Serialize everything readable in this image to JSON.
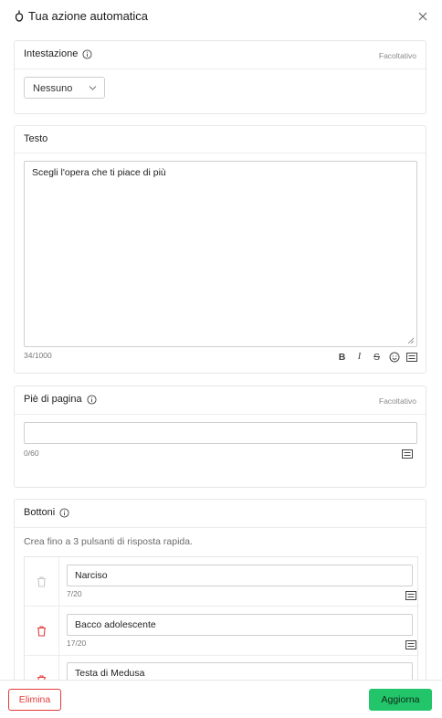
{
  "header": {
    "title": "Tua azione automatica",
    "title_icon": "bulb-icon",
    "close_icon": "close-icon"
  },
  "heading_section": {
    "label": "Intestazione",
    "optional": "Facoltativo",
    "select_value": "Nessuno"
  },
  "text_section": {
    "label": "Testo",
    "value": "Scegli l'opera che ti piace di più",
    "counter": "34/1000",
    "format_tools": [
      "bold-icon",
      "italic-icon",
      "strikethrough-icon",
      "emoji-icon",
      "variable-icon"
    ]
  },
  "footer_section": {
    "label": "Piè di pagina",
    "optional": "Facoltativo",
    "value": "",
    "counter": "0/60"
  },
  "buttons_section": {
    "label": "Bottoni",
    "hint": "Crea fino a 3 pulsanti di risposta rapida.",
    "items": [
      {
        "value": "Narciso",
        "counter": "7/20",
        "delete_enabled": false
      },
      {
        "value": "Bacco adolescente",
        "counter": "17/20",
        "delete_enabled": true
      },
      {
        "value": "Testa di Medusa",
        "counter": "",
        "delete_enabled": true
      }
    ]
  },
  "actions": {
    "delete_label": "Elimina",
    "update_label": "Aggiorna"
  },
  "colors": {
    "danger": "#e23b3b",
    "primary": "#22c56a",
    "border": "#e6e6e6",
    "muted_text": "#8a8a8a"
  }
}
